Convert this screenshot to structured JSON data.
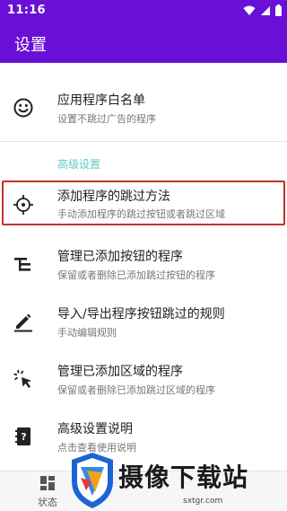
{
  "status_bar": {
    "time": "11:16"
  },
  "app_bar": {
    "title": "设置"
  },
  "items": [
    {
      "title": "应用程序白名单",
      "subtitle": "设置不跳过广告的程序",
      "icon": "smiley-icon"
    },
    {
      "title": "添加程序的跳过方法",
      "subtitle": "手动添加程序的跳过按钮或者跳过区域",
      "icon": "crosshair-icon"
    },
    {
      "title": "管理已添加按钮的程序",
      "subtitle": "保留或者删除已添加跳过按钮的程序",
      "icon": "list-tree-icon"
    },
    {
      "title": "导入/导出程序按钮跳过的规则",
      "subtitle": "手动编辑规则",
      "icon": "pencil-icon"
    },
    {
      "title": "管理已添加区域的程序",
      "subtitle": "保留或者删除已添加跳过区域的程序",
      "icon": "click-cursor-icon"
    },
    {
      "title": "高级设置说明",
      "subtitle": "点击查看使用说明",
      "icon": "help-book-icon"
    }
  ],
  "section": {
    "advanced_header": "高级设置"
  },
  "bottom_nav": {
    "status_label": "状态"
  },
  "watermark": {
    "text": "摄像下载站",
    "url": "sxtgr.com"
  },
  "colors": {
    "primary": "#6a10d6",
    "accent": "#63c7c7",
    "highlight": "#c3332b"
  }
}
